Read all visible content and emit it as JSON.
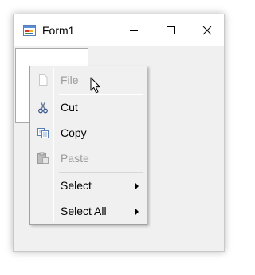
{
  "window": {
    "title": "Form1",
    "icon": "winforms-app-icon",
    "controls": {
      "minimize": "minimize-icon",
      "maximize": "maximize-icon",
      "close": "close-icon"
    }
  },
  "textbox": {
    "value": ""
  },
  "context_menu": {
    "items": [
      {
        "label": "File",
        "enabled": false,
        "icon": "file-icon"
      },
      {
        "label": "Cut",
        "enabled": true,
        "icon": "scissors-icon"
      },
      {
        "label": "Copy",
        "enabled": true,
        "icon": "copy-icon"
      },
      {
        "label": "Paste",
        "enabled": false,
        "icon": "paste-icon"
      },
      {
        "label": "Select",
        "enabled": true,
        "submenu": true
      },
      {
        "label": "Select All",
        "enabled": true,
        "submenu": true
      }
    ]
  },
  "colors": {
    "window_bg": "#f0f0f0",
    "titlebar_bg": "#ffffff",
    "menu_disabled_text": "#9b9b9b",
    "menu_text": "#000000"
  }
}
